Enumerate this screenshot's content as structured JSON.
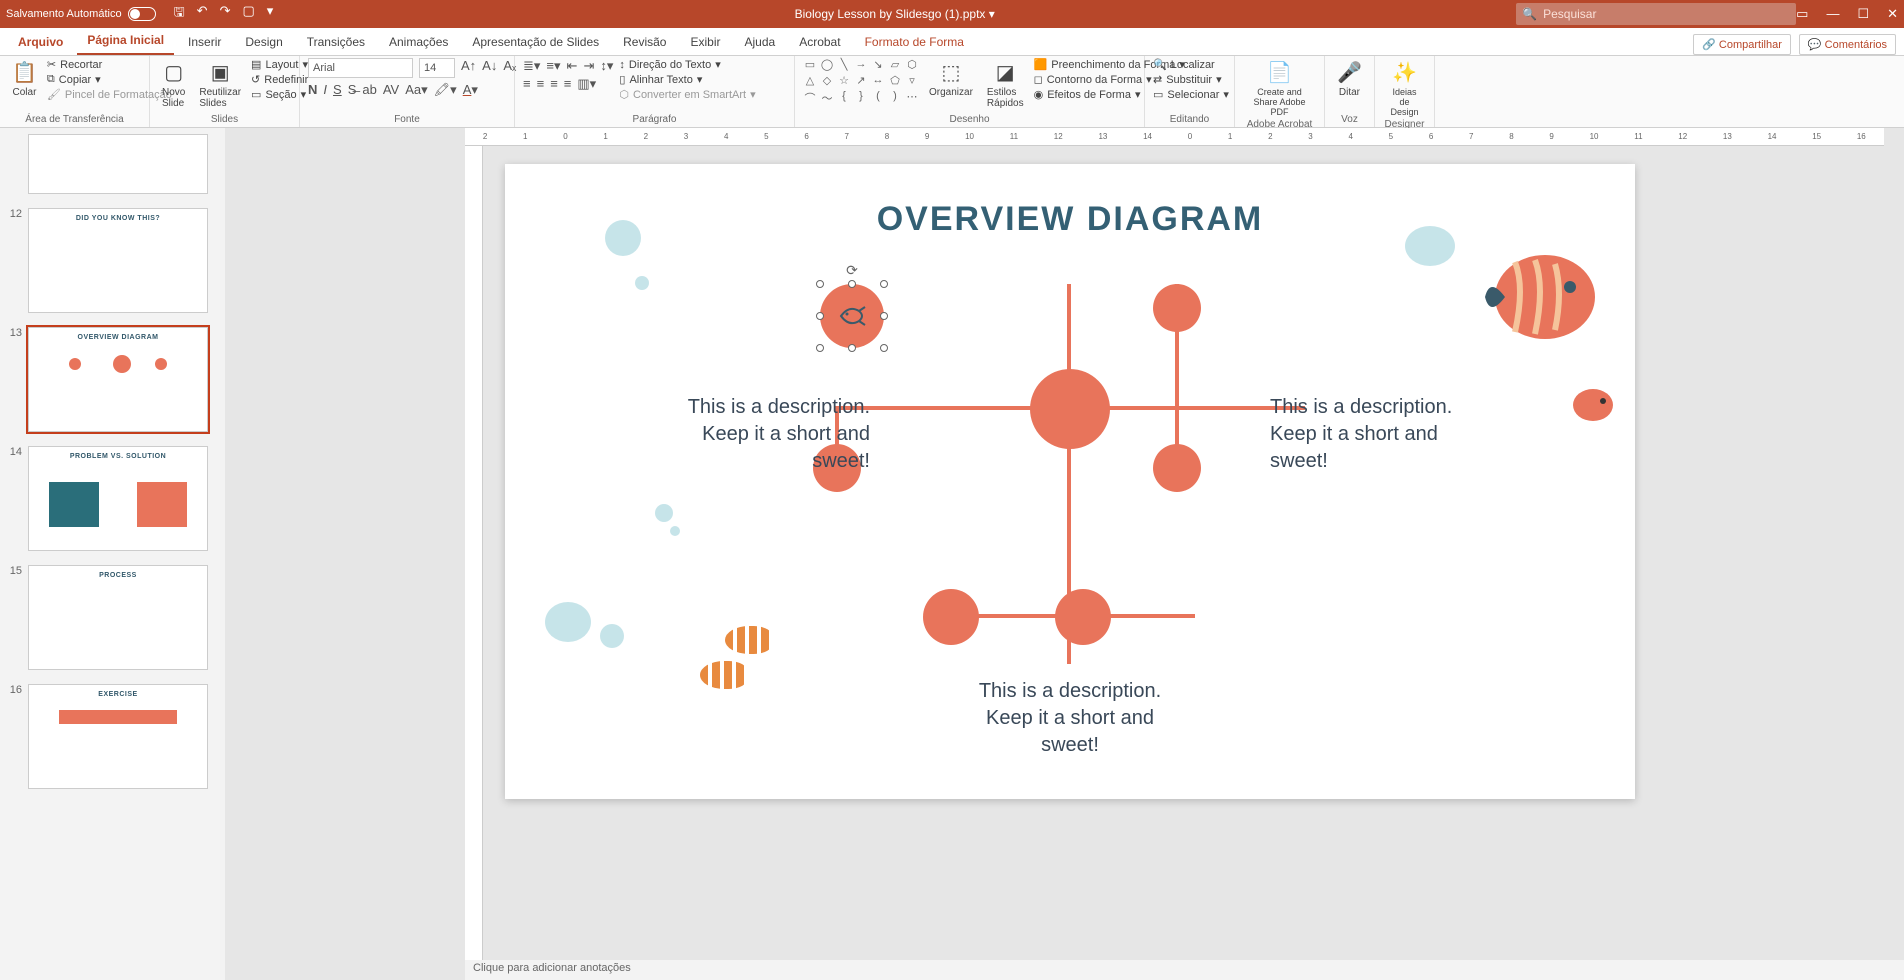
{
  "titlebar": {
    "autosave": "Salvamento Automático",
    "doc_title": "Biology Lesson by Slidesgo (1).pptx",
    "search_placeholder": "Pesquisar"
  },
  "tabs": {
    "file": "Arquivo",
    "home": "Página Inicial",
    "insert": "Inserir",
    "design": "Design",
    "transitions": "Transições",
    "animations": "Animações",
    "slideshow": "Apresentação de Slides",
    "review": "Revisão",
    "view": "Exibir",
    "help": "Ajuda",
    "acrobat": "Acrobat",
    "format": "Formato de Forma",
    "share": "Compartilhar",
    "comments": "Comentários"
  },
  "ribbon": {
    "clipboard": {
      "paste": "Colar",
      "cut": "Recortar",
      "copy": "Copiar",
      "painter": "Pincel de Formatação",
      "label": "Área de Transferência"
    },
    "slides": {
      "new": "Novo Slide",
      "reuse": "Reutilizar Slides",
      "layout": "Layout",
      "reset": "Redefinir",
      "section": "Seção",
      "label": "Slides"
    },
    "font": {
      "name": "Arial",
      "size": "14",
      "label": "Fonte"
    },
    "paragraph": {
      "direction": "Direção do Texto",
      "align": "Alinhar Texto",
      "smartart": "Converter em SmartArt",
      "label": "Parágrafo"
    },
    "drawing": {
      "arrange": "Organizar",
      "quick": "Estilos Rápidos",
      "fill": "Preenchimento da Forma",
      "outline": "Contorno da Forma",
      "effects": "Efeitos de Forma",
      "label": "Desenho"
    },
    "editing": {
      "find": "Localizar",
      "replace": "Substituir",
      "select": "Selecionar",
      "label": "Editando"
    },
    "acrobat": {
      "create": "Create and Share Adobe PDF",
      "label": "Adobe Acrobat"
    },
    "voice": {
      "dictate": "Ditar",
      "label": "Voz"
    },
    "designer": {
      "ideas": "Ideias de Design",
      "label": "Designer"
    }
  },
  "thumbs": {
    "n12": "12",
    "t12": "DID YOU KNOW THIS?",
    "n13": "13",
    "t13": "OVERVIEW DIAGRAM",
    "n14": "14",
    "t14": "PROBLEM VS. SOLUTION",
    "n15": "15",
    "t15": "PROCESS",
    "n16": "16",
    "t16": "EXERCISE"
  },
  "slide": {
    "title": "OVERVIEW DIAGRAM",
    "desc1_l1": "This is a description.",
    "desc1_l2": "Keep it a short and",
    "desc1_l3": "sweet!",
    "desc2_l1": "This is a description.",
    "desc2_l2": "Keep it a short and",
    "desc2_l3": "sweet!",
    "desc3_l1": "This is a description.",
    "desc3_l2": "Keep it a short and",
    "desc3_l3": "sweet!"
  },
  "ruler_marks": [
    "2",
    "1",
    "0",
    "1",
    "2",
    "3",
    "4",
    "5",
    "6",
    "7",
    "8",
    "9",
    "10",
    "11",
    "12",
    "13",
    "14",
    "0",
    "1",
    "2",
    "3",
    "4",
    "5",
    "6",
    "7",
    "8",
    "9",
    "10",
    "11",
    "12",
    "13",
    "14",
    "15",
    "16"
  ],
  "status": "Clique para adicionar anotações"
}
